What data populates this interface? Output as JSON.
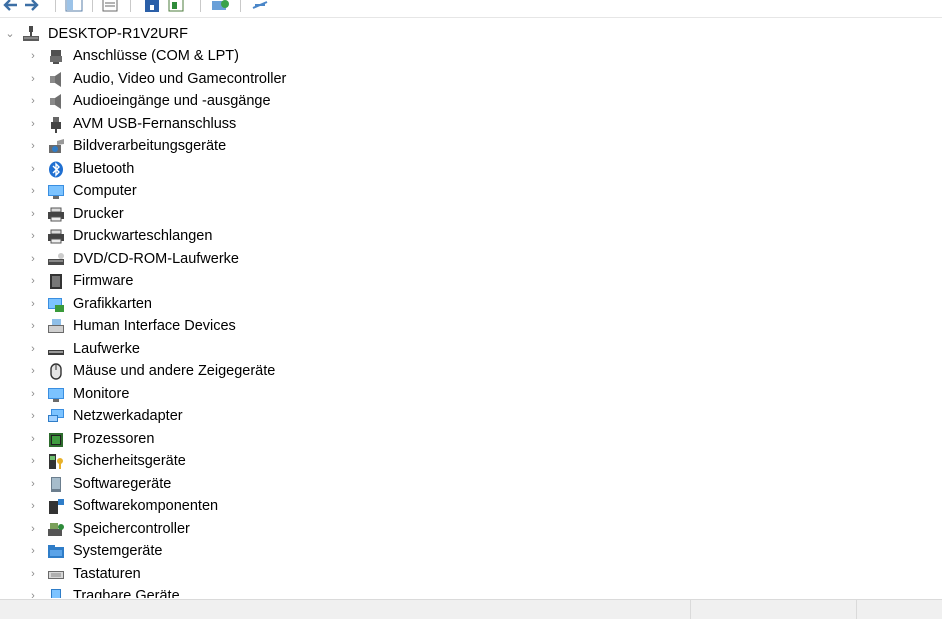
{
  "toolbar": {
    "buttons": [
      "back-arrow-icon",
      "forward-arrow-icon",
      "show-hide-tree-icon",
      "properties-icon",
      "help-icon",
      "update-driver-icon",
      "scan-hardware-icon",
      "remove-device-icon"
    ]
  },
  "tree": {
    "root": {
      "label": "DESKTOP-R1V2URF",
      "expanded": true,
      "icon": "computer-root-icon"
    },
    "items": [
      {
        "label": "Anschlüsse (COM & LPT)",
        "icon": "port-icon"
      },
      {
        "label": "Audio, Video und Gamecontroller",
        "icon": "speaker-icon"
      },
      {
        "label": "Audioeingänge und -ausgänge",
        "icon": "speaker-icon"
      },
      {
        "label": "AVM USB-Fernanschluss",
        "icon": "usb-plug-icon"
      },
      {
        "label": "Bildverarbeitungsgeräte",
        "icon": "camera-icon"
      },
      {
        "label": "Bluetooth",
        "icon": "bluetooth-icon"
      },
      {
        "label": "Computer",
        "icon": "monitor-icon"
      },
      {
        "label": "Drucker",
        "icon": "printer-icon"
      },
      {
        "label": "Druckwarteschlangen",
        "icon": "printer-icon"
      },
      {
        "label": "DVD/CD-ROM-Laufwerke",
        "icon": "optical-drive-icon"
      },
      {
        "label": "Firmware",
        "icon": "firmware-chip-icon"
      },
      {
        "label": "Grafikkarten",
        "icon": "display-adapter-icon"
      },
      {
        "label": "Human Interface Devices",
        "icon": "hid-keyboard-icon"
      },
      {
        "label": "Laufwerke",
        "icon": "disk-drive-icon"
      },
      {
        "label": "Mäuse und andere Zeigegeräte",
        "icon": "mouse-icon"
      },
      {
        "label": "Monitore",
        "icon": "monitor-icon"
      },
      {
        "label": "Netzwerkadapter",
        "icon": "network-icon"
      },
      {
        "label": "Prozessoren",
        "icon": "processor-icon"
      },
      {
        "label": "Sicherheitsgeräte",
        "icon": "security-key-icon"
      },
      {
        "label": "Softwaregeräte",
        "icon": "software-device-icon"
      },
      {
        "label": "Softwarekomponenten",
        "icon": "software-component-icon"
      },
      {
        "label": "Speichercontroller",
        "icon": "storage-controller-icon"
      },
      {
        "label": "Systemgeräte",
        "icon": "system-folder-icon"
      },
      {
        "label": "Tastaturen",
        "icon": "keyboard-icon"
      },
      {
        "label": "Tragbare Geräte",
        "icon": "portable-device-icon"
      }
    ]
  },
  "colors": {
    "background": "#ffffff",
    "chevron": "#8a8a8a",
    "statusbar": "#f0f0f0"
  }
}
